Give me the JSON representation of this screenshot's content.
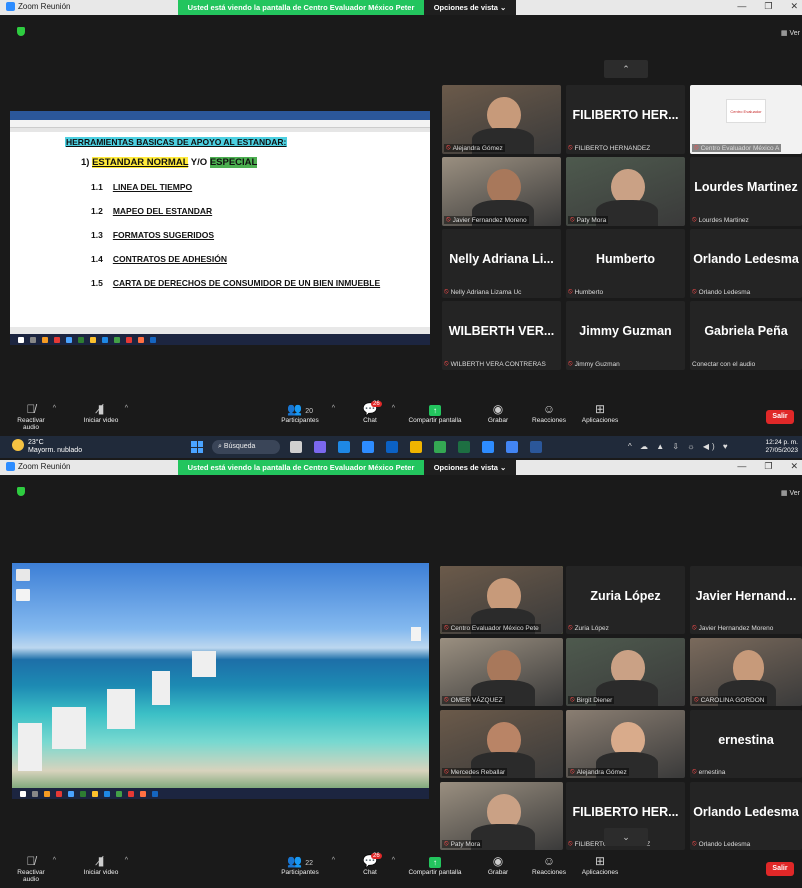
{
  "window1": {
    "app_title": "Zoom Reunión",
    "share_banner": "Usted está viendo la pantalla de Centro Evaluador México Peter",
    "view_options": "Opciones de vista ⌄",
    "view_label": "Ver",
    "document": {
      "heading": "HERRAMIENTAS BASICAS DE APOYO AL ESTANDAR:",
      "sub_number": "1)",
      "sub_normal": "ESTANDAR NORMAL",
      "sub_connector": " Y/O ",
      "sub_special": "ESPECIAL",
      "items": [
        {
          "num": "1.1",
          "text": "LINEA DEL TIEMPO"
        },
        {
          "num": "1.2",
          "text": "MAPEO DEL ESTANDAR"
        },
        {
          "num": "1.3",
          "text": "FORMATOS SUGERIDOS"
        },
        {
          "num": "1.4",
          "text": "CONTRATOS DE ADHESIÓN"
        },
        {
          "num": "1.5",
          "text": "CARTA DE DERECHOS DE CONSUMIDOR DE UN BIEN INMUEBLE"
        }
      ]
    },
    "gallery": [
      {
        "big": "",
        "label": "Alejandra Gómez",
        "video": true
      },
      {
        "big": "FILIBERTO HER...",
        "label": "FILIBERTO HERNANDEZ",
        "video": false
      },
      {
        "big": "",
        "label": "Centro Evaluador México A",
        "video": true,
        "logo": "Centro Evaluador"
      },
      {
        "big": "",
        "label": "Javier Fernandez Moreno",
        "video": true
      },
      {
        "big": "",
        "label": "Paty Mora",
        "video": true
      },
      {
        "big": "Lourdes Martinez",
        "label": "Lourdes Martinez",
        "video": false
      },
      {
        "big": "Nelly Adriana Li...",
        "label": "Nelly Adriana Lizama Uc",
        "video": false
      },
      {
        "big": "Humberto",
        "label": "Humberto",
        "video": false
      },
      {
        "big": "Orlando Ledesma",
        "label": "Orlando Ledesma",
        "video": false
      },
      {
        "big": "WILBERTH VER...",
        "label": "WILBERTH VERA CONTRERAS",
        "video": false
      },
      {
        "big": "Jimmy Guzman",
        "label": "Jimmy Guzman",
        "video": false
      },
      {
        "big": "Gabriela Peña",
        "label": "Conectar con el audio",
        "video": false
      }
    ],
    "toolbar": {
      "audio": "Reactivar audio",
      "video": "Iniciar video",
      "participants": "Participantes",
      "participants_count": "20",
      "chat": "Chat",
      "chat_badge": "26",
      "share": "Compartir pantalla",
      "record": "Grabar",
      "reactions": "Reacciones",
      "apps": "Aplicaciones",
      "leave": "Salir"
    }
  },
  "taskbar": {
    "temp": "23°C",
    "weather": "Mayorm. nublado",
    "search": "Búsqueda",
    "time": "12:24 p. m.",
    "date": "27/05/2023"
  },
  "window2": {
    "app_title": "Zoom Reunión",
    "share_banner": "Usted está viendo la pantalla de Centro Evaluador México Peter",
    "view_options": "Opciones de vista ⌄",
    "view_label": "Ver",
    "gallery": [
      {
        "big": "",
        "label": "Centro Evaluador México Pete",
        "video": true,
        "active": true
      },
      {
        "big": "Zuria López",
        "label": "Zuria López",
        "video": false
      },
      {
        "big": "Javier Hernand...",
        "label": "Javier Hernandez Moreno",
        "video": false
      },
      {
        "big": "",
        "label": "OMER VÁZQUEZ",
        "video": true
      },
      {
        "big": "",
        "label": "Birgit Diener",
        "video": true
      },
      {
        "big": "",
        "label": "CAROLINA GORDON",
        "video": true
      },
      {
        "big": "",
        "label": "Mercedes Reballar",
        "video": true
      },
      {
        "big": "",
        "label": "Alejandra Gómez",
        "video": true
      },
      {
        "big": "ernestina",
        "label": "ernestina",
        "video": false
      },
      {
        "big": "",
        "label": "Paty Mora",
        "video": true
      },
      {
        "big": "FILIBERTO HER...",
        "label": "FILIBERTO HERNANDEZ",
        "video": false
      },
      {
        "big": "Orlando Ledesma",
        "label": "Orlando Ledesma",
        "video": false
      }
    ],
    "toolbar": {
      "audio": "Reactivar audio",
      "video": "Iniciar video",
      "participants": "Participantes",
      "participants_count": "22",
      "chat": "Chat",
      "chat_badge": "26",
      "share": "Compartir pantalla",
      "record": "Grabar",
      "reactions": "Reacciones",
      "apps": "Aplicaciones",
      "leave": "Salir"
    }
  },
  "colors": {
    "share_banner": "#23c55e",
    "leave": "#e02828",
    "active_speaker": "#b6e54e"
  }
}
